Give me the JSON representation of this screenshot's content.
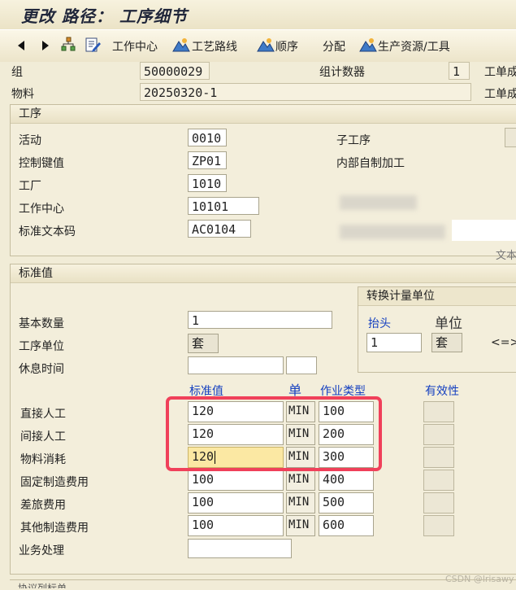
{
  "title": "更改 路径： 工序细节",
  "toolbar": {
    "items": [
      {
        "label": "工作中心"
      },
      {
        "label": "工艺路线"
      },
      {
        "label": "顺序"
      },
      {
        "label": "分配"
      },
      {
        "label": "生产资源/工具"
      }
    ]
  },
  "header": {
    "group_label": "组",
    "group_value": "50000029",
    "group_counter_label": "组计数器",
    "group_counter_value": "1",
    "material_label": "物料",
    "material_value": "20250320-1",
    "right_cut_1": "工单成",
    "right_cut_2": "工单成"
  },
  "operation": {
    "section_title": "工序",
    "activity_label": "活动",
    "activity_value": "0010",
    "control_key_label": "控制键值",
    "control_key_value": "ZP01",
    "plant_label": "工厂",
    "plant_value": "1010",
    "work_center_label": "工作中心",
    "work_center_value": "10101",
    "std_text_label": "标准文本码",
    "std_text_value": "AC0104",
    "sub_op_label": "子工序",
    "internal_label": "内部自制加工",
    "text_cut": "文本"
  },
  "standard_values": {
    "section_title": "标准值",
    "base_qty_label": "基本数量",
    "base_qty_value": "1",
    "op_unit_label": "工序单位",
    "op_unit_value": "套",
    "break_time_label": "休息时间",
    "conversion": {
      "title": "转换计量单位",
      "header_label": "抬头",
      "unit_label": "单位",
      "header_value": "1",
      "unit_value": "套",
      "arrow": "<=>"
    },
    "col_std_value": "标准值",
    "col_unit": "单",
    "col_activity_type": "作业类型",
    "col_validity": "有效性",
    "rows": [
      {
        "label": "直接人工",
        "value": "120",
        "unit": "MIN",
        "type": "100"
      },
      {
        "label": "间接人工",
        "value": "120",
        "unit": "MIN",
        "type": "200"
      },
      {
        "label": "物料消耗",
        "value": "120",
        "unit": "MIN",
        "type": "300"
      },
      {
        "label": "固定制造费用",
        "value": "100",
        "unit": "MIN",
        "type": "400"
      },
      {
        "label": "差旅费用",
        "value": "100",
        "unit": "MIN",
        "type": "500"
      },
      {
        "label": "其他制造费用",
        "value": "100",
        "unit": "MIN",
        "type": "600"
      }
    ],
    "business_label": "业务处理"
  },
  "footer_cut": "协议列标单",
  "watermark": "CSDN @lrisawy"
}
